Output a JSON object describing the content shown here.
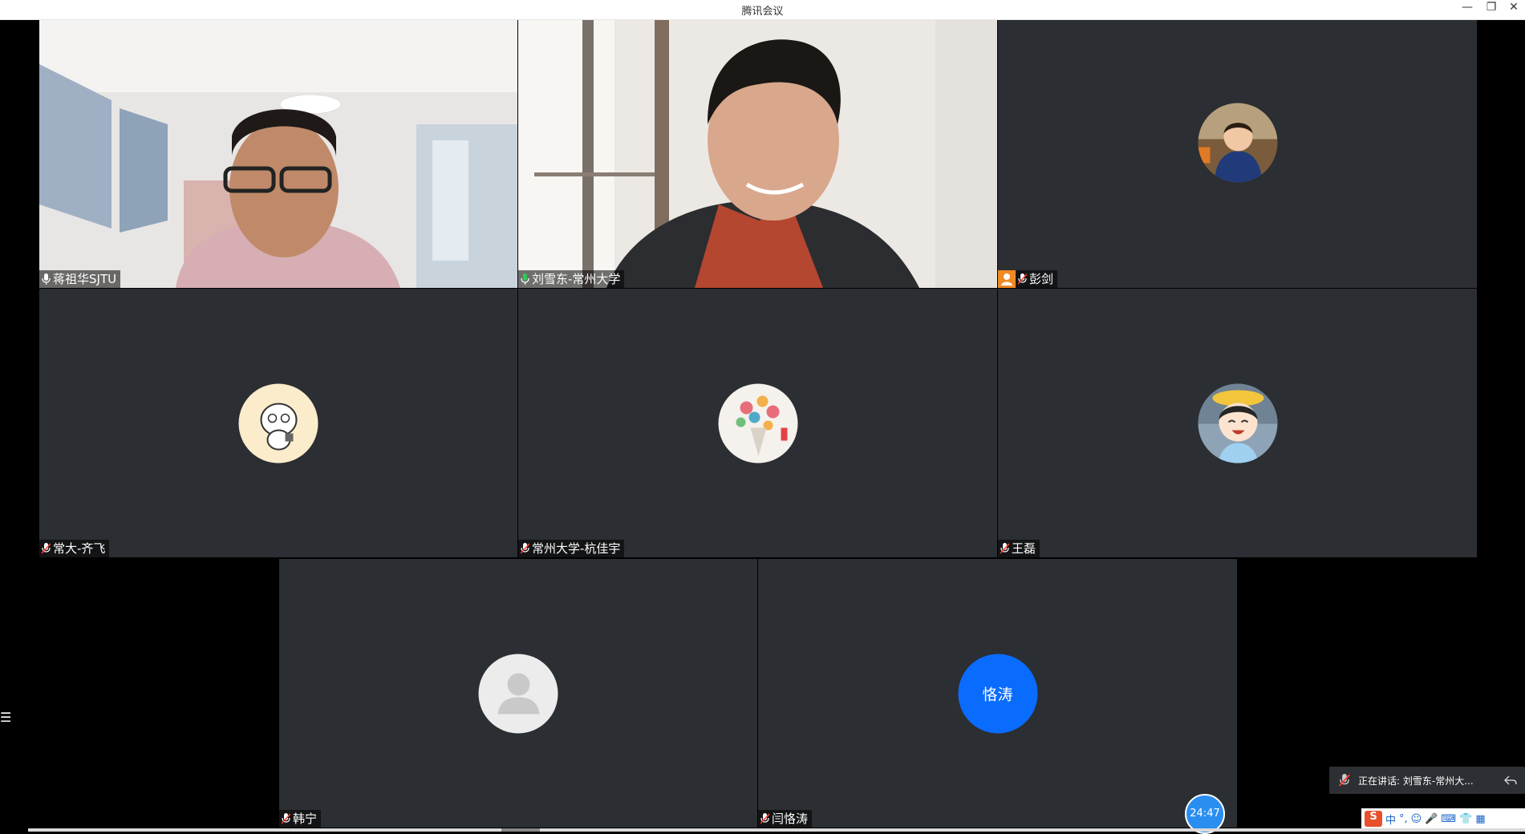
{
  "window": {
    "title": "腾讯会议",
    "minimize_glyph": "—",
    "restore_glyph": "❐",
    "close_glyph": "✕"
  },
  "participants": [
    {
      "name": "蒋祖华SJTU",
      "mic": "on",
      "type": "video"
    },
    {
      "name": "刘雪东-常州大学",
      "mic": "speaking",
      "type": "video",
      "active": true
    },
    {
      "name": "彭剑",
      "mic": "muted",
      "type": "avatar",
      "host_badge": true
    },
    {
      "name": "常大-齐飞",
      "mic": "muted",
      "type": "avatar"
    },
    {
      "name": "常州大学-杭佳宇",
      "mic": "muted",
      "type": "avatar"
    },
    {
      "name": "王磊",
      "mic": "muted",
      "type": "avatar"
    },
    {
      "name": "韩宁",
      "mic": "muted",
      "type": "default-avatar"
    },
    {
      "name": "闫恪涛",
      "mic": "muted",
      "type": "initials",
      "initials": "恪涛"
    }
  ],
  "speaking_indicator": {
    "text": "正在讲话: 刘雪东-常州大...",
    "icon": "mic-muted-icon"
  },
  "timer": "24:47",
  "side_menu_glyph": "☰",
  "ime_toolbar": {
    "items": [
      "S",
      "中",
      "°,",
      "☺",
      "🎤",
      "⌨",
      "👕",
      "▦"
    ]
  },
  "colors": {
    "tile_bg": "#2b2e32",
    "active_border": "#34c759",
    "initials_avatar": "#0a6cff",
    "timer": "#2a8ef0"
  }
}
